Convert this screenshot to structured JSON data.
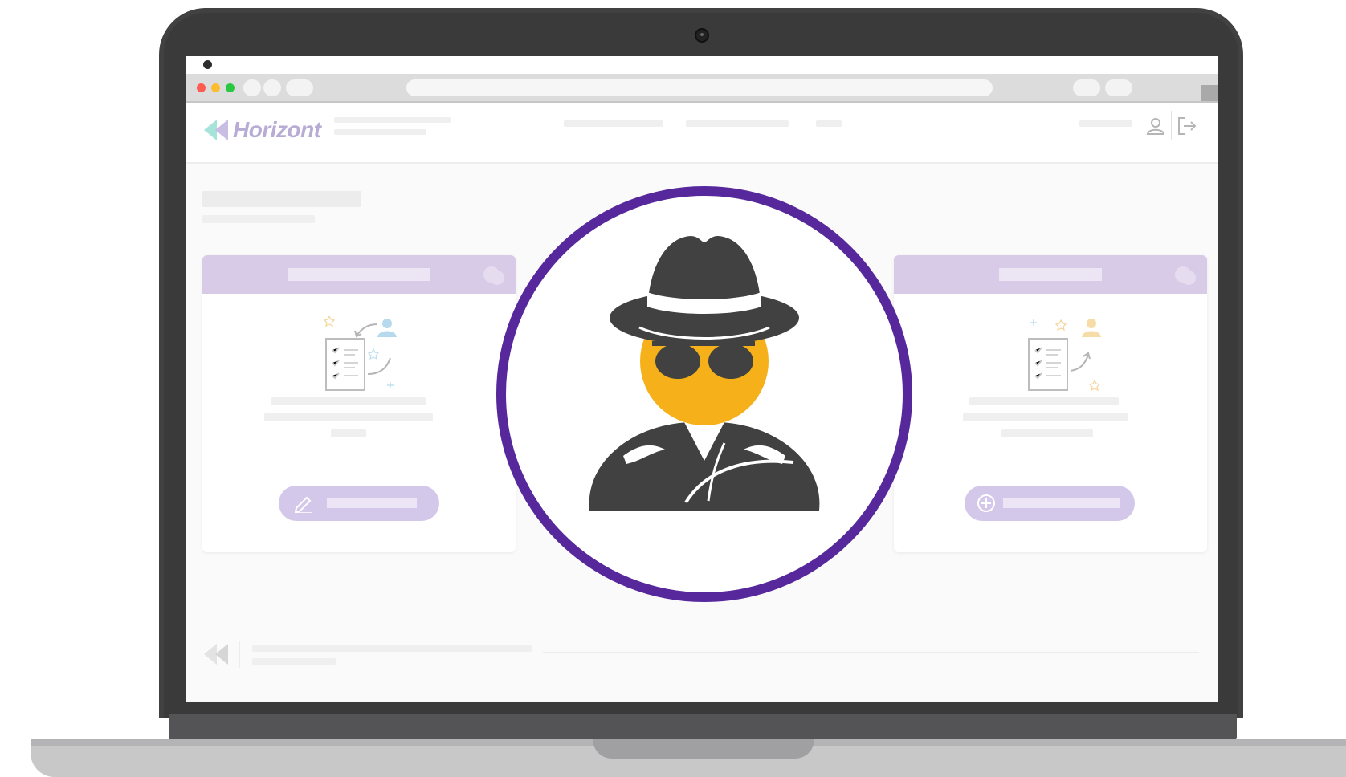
{
  "app": {
    "logo_text": "Horizont"
  },
  "browser": {
    "traffic_lights": [
      "#fd5a52",
      "#fdbb2f",
      "#28c840"
    ]
  },
  "overlay": {
    "icon": "incognito-spy-icon",
    "ring_color": "#57289b",
    "face_color": "#f5b01a",
    "figure_color": "#414141"
  },
  "cards": [
    {
      "icon": "checklist-handoff-icon",
      "button_icon": "pencil-icon"
    },
    {
      "icon": "checklist-assign-icon",
      "button_icon": "plus-circle-icon"
    }
  ],
  "header": {
    "user_icon": "user-icon",
    "logout_icon": "logout-icon"
  },
  "footer": {
    "logo_icon": "horizont-mark-icon"
  }
}
